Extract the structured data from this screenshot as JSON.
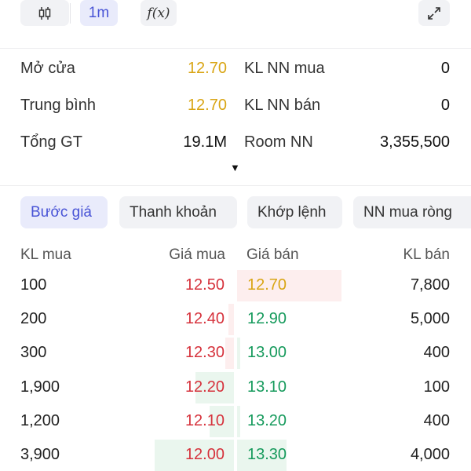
{
  "toolbar": {
    "interval": "1m",
    "fx_label": "f(x)",
    "icons": [
      "candlestick-icon",
      "function-icon",
      "expand-icon"
    ]
  },
  "colors": {
    "reference": "#d9a514",
    "up": "#169a5c",
    "down": "#d6323c",
    "accent": "#4954d6"
  },
  "stats": {
    "rows": [
      {
        "label_left": "Mở cửa",
        "value_left": "12.70",
        "label_right": "KL NN mua",
        "value_right": "0"
      },
      {
        "label_left": "Trung bình",
        "value_left": "12.70",
        "label_right": "KL NN bán",
        "value_right": "0"
      },
      {
        "label_left": "Tổng GT",
        "value_left": "19.1M",
        "label_right": "Room NN",
        "value_right": "3,355,500"
      }
    ],
    "toggle": "▼"
  },
  "tabs": [
    {
      "label": "Bước giá",
      "active": true
    },
    {
      "label": "Thanh khoản",
      "active": false
    },
    {
      "label": "Khớp lệnh",
      "active": false
    },
    {
      "label": "NN mua ròng",
      "active": false
    }
  ],
  "orderbook": {
    "headers": {
      "bid_qty": "KL mua",
      "bid_price": "Giá mua",
      "ask_price": "Giá bán",
      "ask_qty": "KL bán"
    },
    "rows": [
      {
        "bid_qty": "100",
        "bid_price": "12.50",
        "ask_price": "12.70",
        "ask_qty": "7,800",
        "bid_depth": 0.0,
        "ask_depth": 0.95
      },
      {
        "bid_qty": "200",
        "bid_price": "12.40",
        "ask_price": "12.90",
        "ask_qty": "5,000",
        "bid_depth": 0.05,
        "ask_depth": 0.0
      },
      {
        "bid_qty": "300",
        "bid_price": "12.30",
        "ask_price": "13.00",
        "ask_qty": "400",
        "bid_depth": 0.08,
        "ask_depth": 0.03
      },
      {
        "bid_qty": "1,900",
        "bid_price": "12.20",
        "ask_price": "13.10",
        "ask_qty": "100",
        "bid_depth": 0.35,
        "ask_depth": 0.0
      },
      {
        "bid_qty": "1,200",
        "bid_price": "12.10",
        "ask_price": "13.20",
        "ask_qty": "400",
        "bid_depth": 0.22,
        "ask_depth": 0.03
      },
      {
        "bid_qty": "3,900",
        "bid_price": "12.00",
        "ask_price": "13.30",
        "ask_qty": "4,000",
        "bid_depth": 0.72,
        "ask_depth": 0.45
      }
    ]
  }
}
